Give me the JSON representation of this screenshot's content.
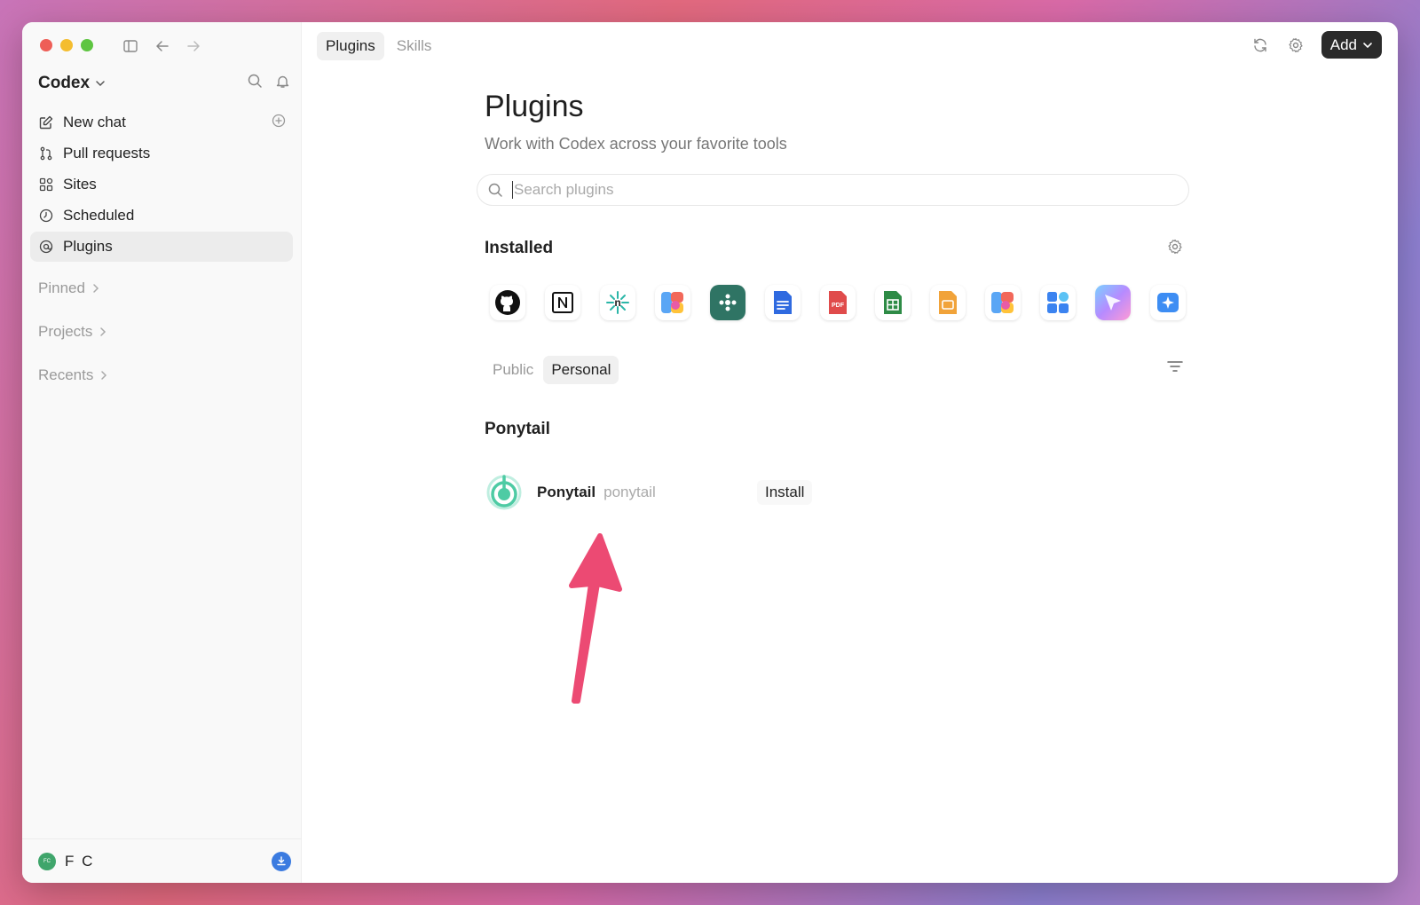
{
  "tabs": [
    {
      "label": "Plugins",
      "active": true
    },
    {
      "label": "Skills",
      "active": false
    }
  ],
  "top_right": {
    "refresh_icon": "refresh-icon",
    "settings_icon": "gear-icon",
    "add_label": "Add"
  },
  "sidebar": {
    "workspace": "Codex",
    "items": [
      {
        "label": "New chat",
        "icon": "compose-icon"
      },
      {
        "label": "Pull requests",
        "icon": "pull-request-icon"
      },
      {
        "label": "Sites",
        "icon": "sites-icon"
      },
      {
        "label": "Scheduled",
        "icon": "clock-icon"
      },
      {
        "label": "Plugins",
        "icon": "plugin-icon",
        "active": true
      }
    ],
    "sections": [
      "Pinned",
      "Projects",
      "Recents"
    ],
    "user": {
      "initials": "FC",
      "name": "F C"
    }
  },
  "main": {
    "title": "Plugins",
    "subtitle": "Work with Codex across your favorite tools",
    "search_placeholder": "Search plugins",
    "installed_title": "Installed",
    "installed_icons": [
      "github-icon",
      "notion-icon",
      "n8n-icon",
      "figma-like-icon",
      "connector-icon",
      "docs-icon",
      "pdf-icon",
      "sheets-icon",
      "slides-icon",
      "figma-like-icon-2",
      "apps-grid-icon",
      "cursor-icon",
      "sparkle-icon"
    ],
    "pdf_text": "PDF",
    "filter_tabs": [
      {
        "label": "Public",
        "active": false
      },
      {
        "label": "Personal",
        "active": true
      }
    ],
    "section_title": "Ponytail",
    "plugin": {
      "name": "Ponytail",
      "id": "ponytail",
      "action": "Install"
    }
  },
  "colors": {
    "accent": "#2b2b2b",
    "arrow": "#ec4a73",
    "ponytail": "#4ecba4"
  }
}
